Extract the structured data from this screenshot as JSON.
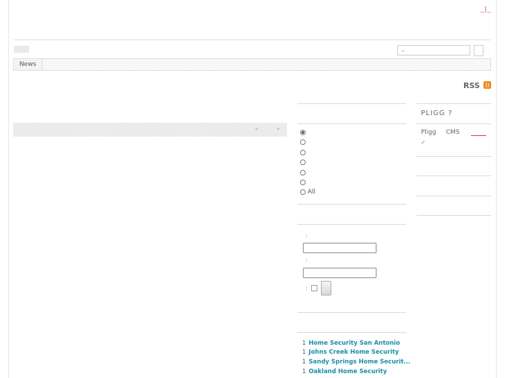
{
  "header": {
    "top_links": "_|_"
  },
  "search": {
    "placeholder": "..",
    "value": ".."
  },
  "nav": {
    "tabs": [
      {
        "label": "News"
      }
    ]
  },
  "rss": {
    "label": "RSS"
  },
  "pager": {
    "prev": "«",
    "next": "»"
  },
  "filter": {
    "options": [
      {
        "label": "",
        "checked": true
      },
      {
        "label": "",
        "checked": false
      },
      {
        "label": "",
        "checked": false
      },
      {
        "label": "",
        "checked": false
      },
      {
        "label": "",
        "checked": false
      },
      {
        "label": "",
        "checked": false
      },
      {
        "label": "All",
        "checked": false
      }
    ]
  },
  "login": {
    "username_label": ":",
    "password_label": ":",
    "remember_label": ":"
  },
  "links": [
    {
      "count": "1",
      "title": "Home Security San Antonio"
    },
    {
      "count": "1",
      "title": "Johns Creek Home Security"
    },
    {
      "count": "1",
      "title": "Sandy Springs Home Securit..."
    },
    {
      "count": "1",
      "title": "Oakland Home Security"
    }
  ],
  "sidebar": {
    "heading": "PLIGG ?",
    "text_left": "Pligg",
    "text_right": "CMS",
    "mark": "✓"
  },
  "colors": {
    "accent_link": "#1a8fa8",
    "top_link": "#dd3333",
    "rss_icon": "#f08a24"
  }
}
